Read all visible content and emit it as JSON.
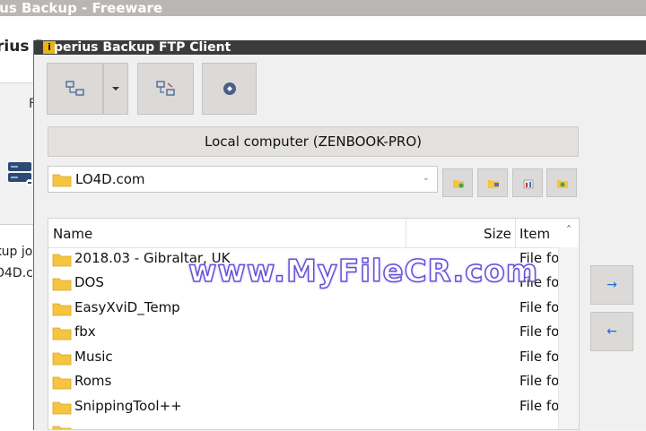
{
  "background_window": {
    "title": "ius Backup - Freeware",
    "header_title": "rius B",
    "sidebar_items": [
      "kup jo",
      "O4D.co"
    ]
  },
  "dialog": {
    "title": "perius Backup FTP Client",
    "app_icon_letter": "i",
    "toolbar": [
      {
        "icon": "connect-icon"
      },
      {
        "icon": "dropdown-arrow-icon"
      },
      {
        "icon": "disconnect-icon"
      },
      {
        "icon": "stop-icon"
      }
    ],
    "location_label": "Local computer  (ZENBOOK-PRO)",
    "path_value": "LO4D.com",
    "file_list": {
      "columns": [
        "Name",
        "Size",
        "Item"
      ],
      "rows": [
        {
          "name": "2018.03 - Gibraltar, UK",
          "type": "File fo"
        },
        {
          "name": "DOS",
          "type": "File fo"
        },
        {
          "name": "EasyXviD_Temp",
          "type": "File fo"
        },
        {
          "name": "fbx",
          "type": "File fo"
        },
        {
          "name": "Music",
          "type": "File fo"
        },
        {
          "name": "Roms",
          "type": "File fo"
        },
        {
          "name": "SnippingTool++",
          "type": "File fo"
        },
        {
          "name": "",
          "type": ""
        }
      ]
    },
    "transfer_buttons": {
      "upload": "→",
      "download": "←"
    }
  },
  "watermark": "www.MyFileCR.com",
  "colors": {
    "folder": "#f5c542",
    "accent_arrow": "#1e6bd6",
    "title_bar": "#3b3b3b"
  }
}
